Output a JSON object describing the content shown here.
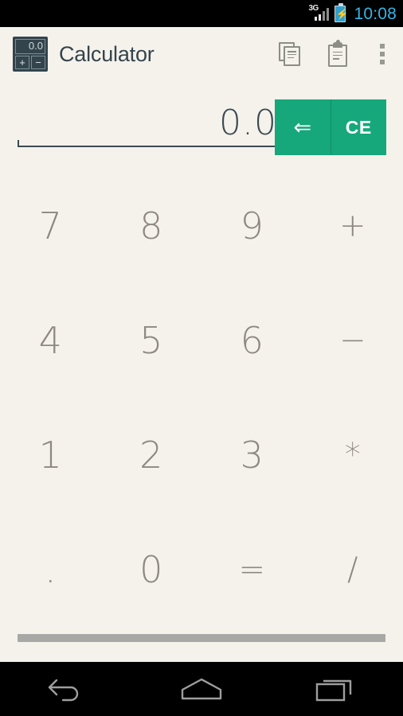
{
  "status_bar": {
    "network_label": "3G",
    "network_icon": "signal-3g-icon",
    "battery_icon": "battery-charging-icon",
    "battery_bolt": "⚡",
    "time": "10:08",
    "time_color": "#33b5e5",
    "background": "#000000"
  },
  "action_bar": {
    "app_icon": {
      "name": "calculator-app-icon",
      "display_value": "0.0",
      "key_plus": "+",
      "key_minus": "−",
      "background": "#33444c"
    },
    "title": "Calculator",
    "title_color": "#34444c",
    "background": "#f5f2ec",
    "actions": [
      {
        "name": "copy-icon",
        "label": "Copy"
      },
      {
        "name": "paste-icon",
        "label": "Paste"
      },
      {
        "name": "overflow-menu-icon",
        "label": "More options"
      }
    ]
  },
  "display": {
    "value": "0.0",
    "value_color": "#3a4a52",
    "underline_color": "#3b4a52",
    "edit_keys": [
      {
        "name": "backspace-button",
        "label": "⇐"
      },
      {
        "name": "clear-entry-button",
        "label": "CE"
      }
    ],
    "edit_key_background": "#16a87a",
    "edit_key_text_color": "#ffffff"
  },
  "keypad": {
    "text_color": "#8d8880",
    "rows": [
      [
        {
          "name": "key-7",
          "label": "7",
          "type": "digit"
        },
        {
          "name": "key-8",
          "label": "8",
          "type": "digit"
        },
        {
          "name": "key-9",
          "label": "9",
          "type": "digit"
        },
        {
          "name": "key-plus",
          "label": "+",
          "type": "operator"
        }
      ],
      [
        {
          "name": "key-4",
          "label": "4",
          "type": "digit"
        },
        {
          "name": "key-5",
          "label": "5",
          "type": "digit"
        },
        {
          "name": "key-6",
          "label": "6",
          "type": "digit"
        },
        {
          "name": "key-minus",
          "label": "−",
          "type": "operator"
        }
      ],
      [
        {
          "name": "key-1",
          "label": "1",
          "type": "digit"
        },
        {
          "name": "key-2",
          "label": "2",
          "type": "digit"
        },
        {
          "name": "key-3",
          "label": "3",
          "type": "digit"
        },
        {
          "name": "key-multiply",
          "label": "*",
          "type": "operator"
        }
      ],
      [
        {
          "name": "key-decimal",
          "label": ".",
          "type": "decimal"
        },
        {
          "name": "key-0",
          "label": "0",
          "type": "digit"
        },
        {
          "name": "key-equals",
          "label": "=",
          "type": "operator"
        },
        {
          "name": "key-divide",
          "label": "/",
          "type": "operator"
        }
      ]
    ]
  },
  "scrollbar": {
    "name": "horizontal-scrollbar",
    "thumb_color": "#a8a8a6"
  },
  "nav_bar": {
    "background": "#000000",
    "buttons": [
      {
        "name": "nav-back-button",
        "label": "Back"
      },
      {
        "name": "nav-home-button",
        "label": "Home"
      },
      {
        "name": "nav-recents-button",
        "label": "Recents"
      }
    ]
  },
  "page_background": "#f5f2ec"
}
